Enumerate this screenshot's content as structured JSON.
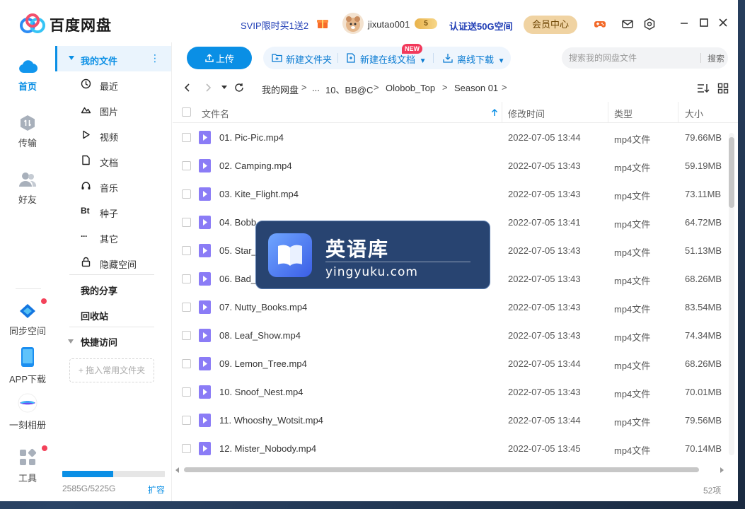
{
  "titlebar": {
    "app_name": "百度网盘",
    "svip_promo": "SVIP限时买1送2",
    "username": "jixutao001",
    "vip_level": "5",
    "verify_text": "认证送50G空间",
    "member_center": "会员中心"
  },
  "leftnav": {
    "items": [
      {
        "label": "首页",
        "icon": "cloud-home-icon",
        "active": true
      },
      {
        "label": "传输",
        "icon": "transfer-icon"
      },
      {
        "label": "好友",
        "icon": "friends-icon"
      },
      {
        "label": "同步空间",
        "icon": "sync-space-icon",
        "dot": true
      },
      {
        "label": "APP下载",
        "icon": "phone-icon"
      },
      {
        "label": "一刻相册",
        "icon": "album-icon"
      },
      {
        "label": "工具",
        "icon": "tools-icon",
        "dot": true
      }
    ]
  },
  "sidebar": {
    "my_files": "我的文件",
    "sub_items": [
      {
        "label": "最近",
        "icon": "clock-icon"
      },
      {
        "label": "图片",
        "icon": "image-icon"
      },
      {
        "label": "视频",
        "icon": "video-icon"
      },
      {
        "label": "文档",
        "icon": "document-icon"
      },
      {
        "label": "音乐",
        "icon": "headphones-icon"
      },
      {
        "label": "种子",
        "icon": "bt-icon",
        "glyph": "Bt"
      },
      {
        "label": "其它",
        "icon": "more-icon",
        "glyph": "···"
      },
      {
        "label": "隐藏空间",
        "icon": "lock-icon"
      }
    ],
    "my_share": "我的分享",
    "recycle_bin": "回收站",
    "quick_access": "快捷访问",
    "drag_hint": "+ 拖入常用文件夹",
    "storage_text": "2585G/5225G",
    "storage_used_fraction": 0.495,
    "expand": "扩容"
  },
  "toolbar": {
    "upload": "上传",
    "new_folder": "新建文件夹",
    "new_online_doc": "新建在线文档",
    "new_badge": "NEW",
    "offline_download": "离线下载",
    "search_placeholder": "搜索我的网盘文件",
    "search_button": "搜索"
  },
  "breadcrumb": {
    "items": [
      "我的网盘",
      "...",
      "10、BB@C",
      "Olobob_Top",
      "Season 01"
    ]
  },
  "table": {
    "headers": {
      "name": "文件名",
      "modified": "修改时间",
      "type": "类型",
      "size": "大小"
    },
    "rows": [
      {
        "name": "01. Pic-Pic.mp4",
        "modified": "2022-07-05 13:44",
        "type": "mp4文件",
        "size": "79.66MB"
      },
      {
        "name": "02. Camping.mp4",
        "modified": "2022-07-05 13:43",
        "type": "mp4文件",
        "size": "59.19MB"
      },
      {
        "name": "03. Kite_Flight.mp4",
        "modified": "2022-07-05 13:43",
        "type": "mp4文件",
        "size": "73.11MB"
      },
      {
        "name": "04. Bobb",
        "modified": "2022-07-05 13:41",
        "type": "mp4文件",
        "size": "64.72MB"
      },
      {
        "name": "05. Star_",
        "modified": "2022-07-05 13:43",
        "type": "mp4文件",
        "size": "51.13MB"
      },
      {
        "name": "06. Bad_",
        "modified": "2022-07-05 13:43",
        "type": "mp4文件",
        "size": "68.26MB"
      },
      {
        "name": "07. Nutty_Books.mp4",
        "modified": "2022-07-05 13:43",
        "type": "mp4文件",
        "size": "83.54MB"
      },
      {
        "name": "08. Leaf_Show.mp4",
        "modified": "2022-07-05 13:43",
        "type": "mp4文件",
        "size": "74.34MB"
      },
      {
        "name": "09. Lemon_Tree.mp4",
        "modified": "2022-07-05 13:44",
        "type": "mp4文件",
        "size": "68.26MB"
      },
      {
        "name": "10. Snoof_Nest.mp4",
        "modified": "2022-07-05 13:43",
        "type": "mp4文件",
        "size": "70.01MB"
      },
      {
        "name": "11. Whooshy_Wotsit.mp4",
        "modified": "2022-07-05 13:44",
        "type": "mp4文件",
        "size": "79.56MB"
      },
      {
        "name": "12. Mister_Nobody.mp4",
        "modified": "2022-07-05 13:45",
        "type": "mp4文件",
        "size": "70.14MB"
      }
    ]
  },
  "footer": {
    "count": "52项"
  },
  "watermark": {
    "title": "英语库",
    "url": "yingyuku.com"
  },
  "colors": {
    "accent": "#0a8fe5",
    "file_icon": "#8b7cf6",
    "notification": "#f3425a"
  }
}
